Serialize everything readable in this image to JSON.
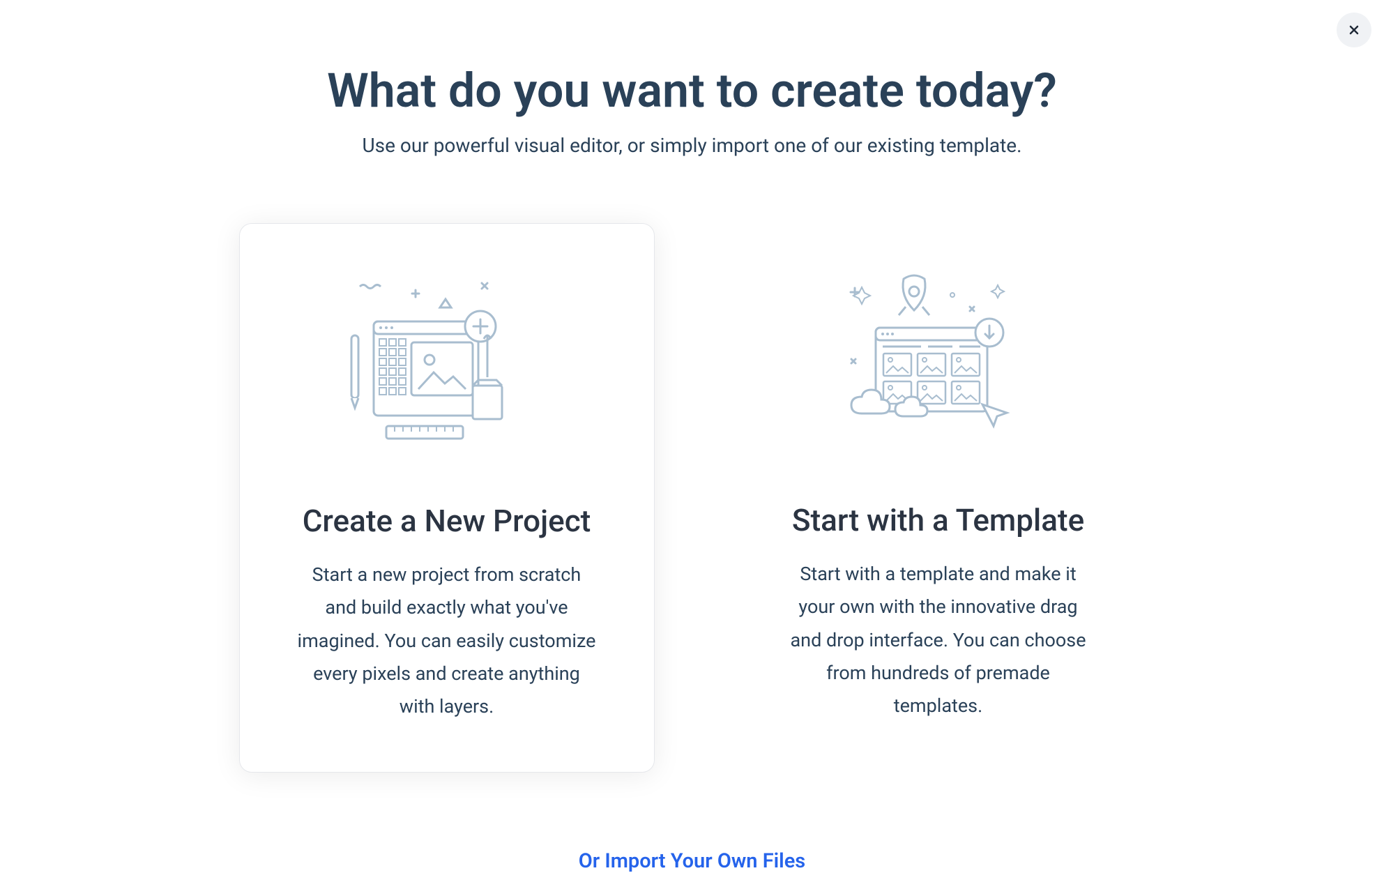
{
  "header": {
    "title": "What do you want to create today?",
    "subtitle": "Use our powerful visual editor, or simply import one of our existing template."
  },
  "options": [
    {
      "title": "Create a New Project",
      "description": "Start a new project from scratch and build exactly what you've imagined. You can easily customize every pixels and create anything with layers."
    },
    {
      "title": "Start with a Template",
      "description": "Start with a template and make it your own with the innovative drag and drop interface. You can choose from hundreds of premade templates."
    }
  ],
  "footer": {
    "import_link": "Or Import Your Own Files"
  },
  "colors": {
    "illustration_stroke": "#A8BDCF",
    "illustration_fill": "#ffffff"
  }
}
